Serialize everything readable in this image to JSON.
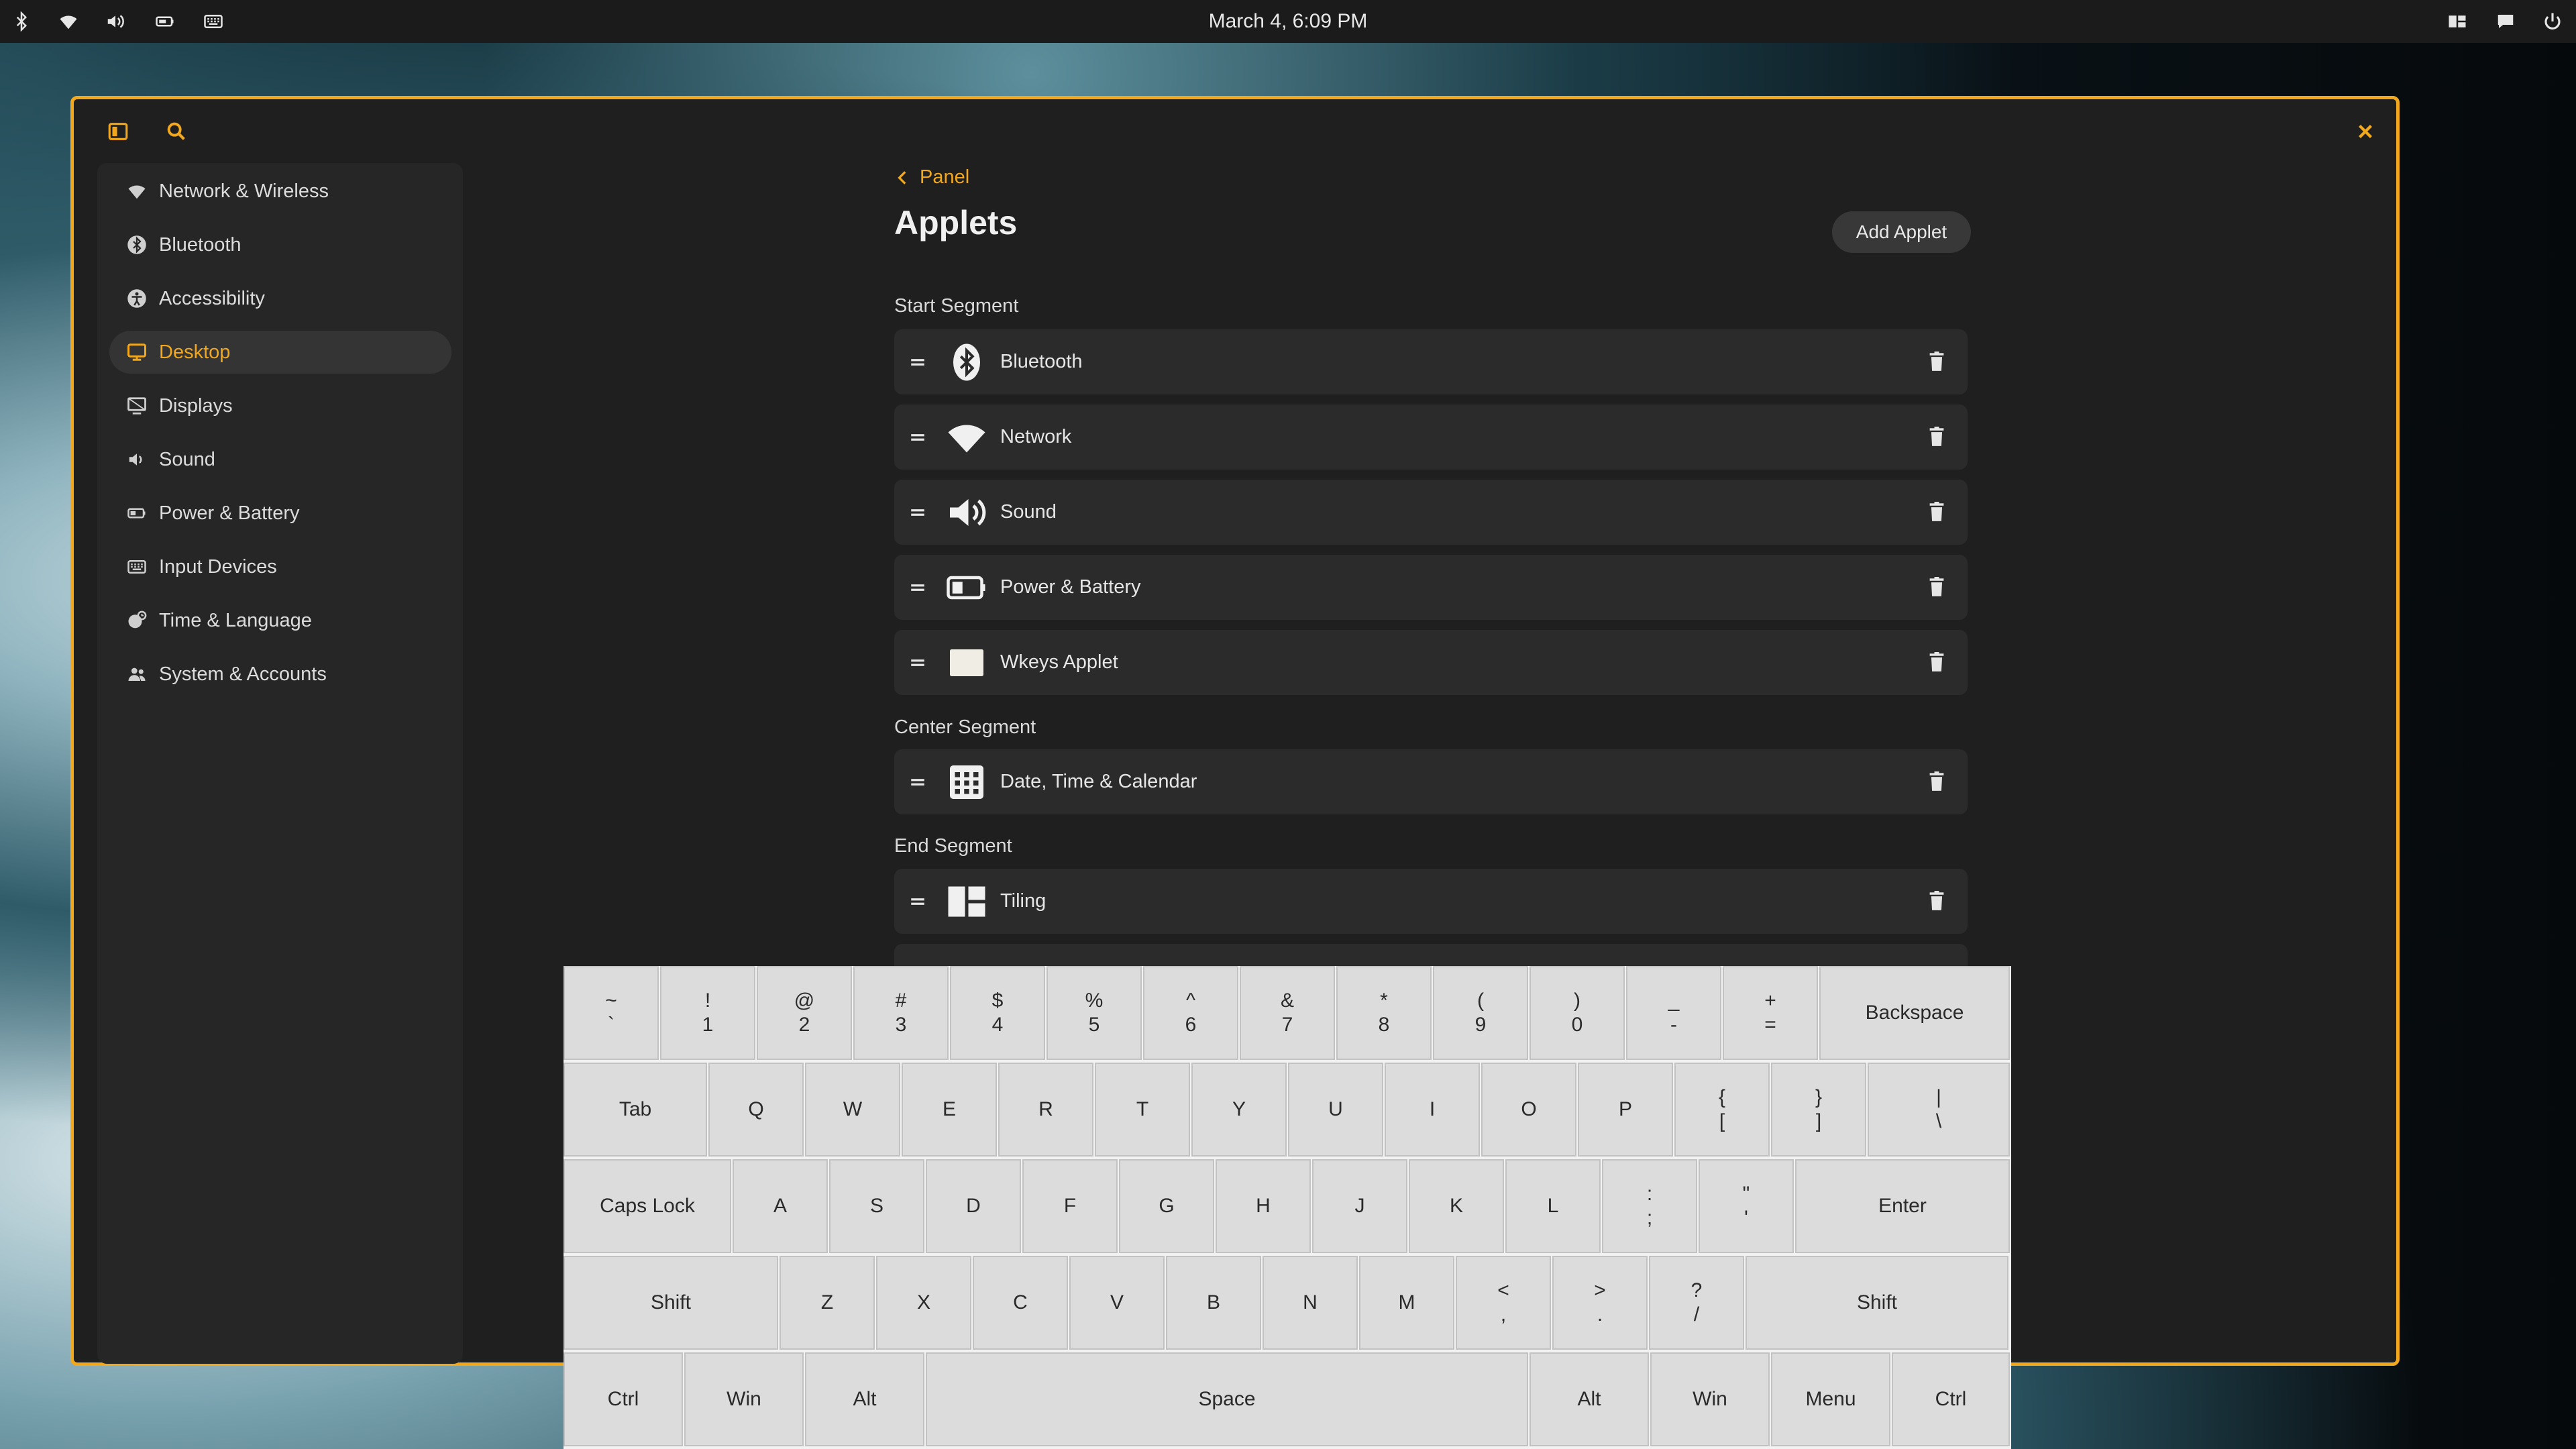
{
  "topbar": {
    "clock": "March 4, 6:09 PM",
    "left_icons": [
      "bluetooth-icon",
      "wifi-icon",
      "volume-icon",
      "battery-icon",
      "keyboard-icon"
    ],
    "right_icons": [
      "tiling-icon",
      "notifications-icon",
      "power-icon"
    ]
  },
  "colors": {
    "accent": "#f2a81d",
    "window_bg": "#1f1f1f",
    "sidebar_bg": "#262626",
    "row_bg": "#2b2b2b"
  },
  "sidebar": {
    "items": [
      {
        "label": "Network & Wireless",
        "icon": "wifi-icon"
      },
      {
        "label": "Bluetooth",
        "icon": "bluetooth-icon"
      },
      {
        "label": "Accessibility",
        "icon": "accessibility-icon"
      },
      {
        "label": "Desktop",
        "icon": "desktop-icon",
        "active": true
      },
      {
        "label": "Displays",
        "icon": "display-icon"
      },
      {
        "label": "Sound",
        "icon": "sound-icon"
      },
      {
        "label": "Power & Battery",
        "icon": "battery-icon"
      },
      {
        "label": "Input Devices",
        "icon": "keyboard-icon"
      },
      {
        "label": "Time & Language",
        "icon": "time-language-icon"
      },
      {
        "label": "System & Accounts",
        "icon": "accounts-icon"
      }
    ]
  },
  "page": {
    "back_label": "Panel",
    "title": "Applets",
    "add_button": "Add Applet",
    "start_segment": "Start Segment",
    "center_segment": "Center Segment",
    "end_segment": "End Segment",
    "start_applets": [
      "Bluetooth",
      "Network",
      "Sound",
      "Power & Battery",
      "Wkeys Applet"
    ],
    "center_applets": [
      "Date, Time & Calendar"
    ],
    "end_applets": [
      "Tiling"
    ]
  },
  "keyboard": {
    "row1": [
      [
        "~",
        "`"
      ],
      [
        "!",
        "1"
      ],
      [
        "@",
        "2"
      ],
      [
        "#",
        "3"
      ],
      [
        "$",
        "4"
      ],
      [
        "%",
        "5"
      ],
      [
        "^",
        "6"
      ],
      [
        "&",
        "7"
      ],
      [
        "*",
        "8"
      ],
      [
        "(",
        "9"
      ],
      [
        ")",
        "0"
      ],
      [
        "_",
        "-"
      ],
      [
        "+",
        "="
      ],
      [
        "Backspace"
      ]
    ],
    "row2": [
      [
        "Tab"
      ],
      [
        "Q"
      ],
      [
        "W"
      ],
      [
        "E"
      ],
      [
        "R"
      ],
      [
        "T"
      ],
      [
        "Y"
      ],
      [
        "U"
      ],
      [
        "I"
      ],
      [
        "O"
      ],
      [
        "P"
      ],
      [
        "{",
        "["
      ],
      [
        "}",
        "]"
      ],
      [
        "|",
        "\\"
      ]
    ],
    "row3": [
      [
        "Caps Lock"
      ],
      [
        "A"
      ],
      [
        "S"
      ],
      [
        "D"
      ],
      [
        "F"
      ],
      [
        "G"
      ],
      [
        "H"
      ],
      [
        "J"
      ],
      [
        "K"
      ],
      [
        "L"
      ],
      [
        ":",
        ";"
      ],
      [
        "\"",
        "'"
      ],
      [
        "Enter"
      ]
    ],
    "row4": [
      [
        "Shift"
      ],
      [
        "Z"
      ],
      [
        "X"
      ],
      [
        "C"
      ],
      [
        "V"
      ],
      [
        "B"
      ],
      [
        "N"
      ],
      [
        "M"
      ],
      [
        "<",
        ","
      ],
      [
        ">",
        "."
      ],
      [
        "?",
        "/"
      ],
      [
        "Shift"
      ]
    ],
    "row5": [
      [
        "Ctrl"
      ],
      [
        "Win"
      ],
      [
        "Alt"
      ],
      [
        "Space"
      ],
      [
        "Alt"
      ],
      [
        "Win"
      ],
      [
        "Menu"
      ],
      [
        "Ctrl"
      ]
    ]
  }
}
